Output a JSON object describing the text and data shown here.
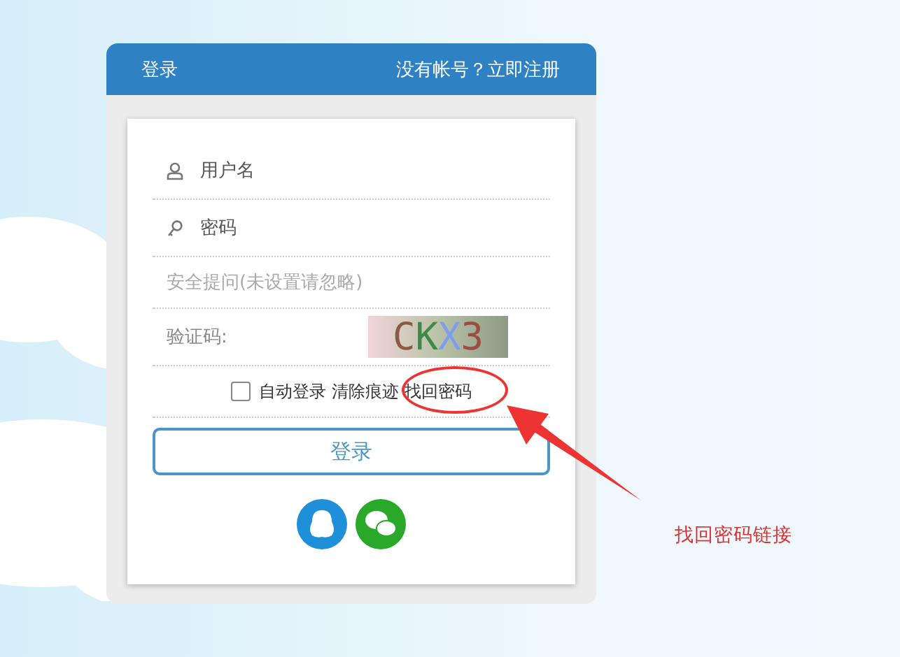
{
  "header": {
    "title": "登录",
    "register_link": "没有帐号？立即注册"
  },
  "form": {
    "username": {
      "placeholder": "用户名"
    },
    "password": {
      "placeholder": "密码"
    },
    "security_question": {
      "value": "安全提问(未设置请忽略)"
    },
    "captcha": {
      "label": "验证码:",
      "code": "CKX3"
    },
    "auto_login": {
      "label": "自动登录",
      "checked": false
    },
    "links": [
      "清除痕迹",
      "找回密码"
    ],
    "submit": "登录"
  },
  "annotation": {
    "text": "找回密码链接"
  }
}
